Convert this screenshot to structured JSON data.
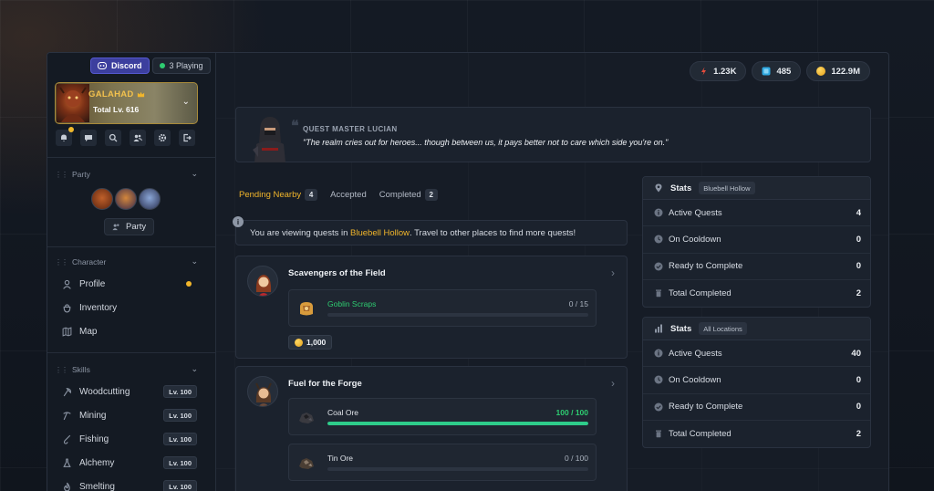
{
  "top": {
    "discord_label": "Discord",
    "playing_label": "3 Playing"
  },
  "hero": {
    "name": "GALAHAD",
    "level": "Total Lv. 616"
  },
  "sidebar": {
    "toolbar_icons": [
      "bell-icon",
      "chat-icon",
      "search-icon",
      "users-icon",
      "gear-icon",
      "logout-icon"
    ],
    "party": {
      "title": "Party",
      "button_label": "Party"
    },
    "character": {
      "title": "Character",
      "items": [
        {
          "label": "Profile",
          "icon": "user-icon",
          "has_notification": true
        },
        {
          "label": "Inventory",
          "icon": "bag-icon"
        },
        {
          "label": "Map",
          "icon": "map-icon"
        }
      ]
    },
    "skills": {
      "title": "Skills",
      "items": [
        {
          "label": "Woodcutting",
          "level": "Lv. 100",
          "icon": "axe-icon"
        },
        {
          "label": "Mining",
          "level": "Lv. 100",
          "icon": "pickaxe-icon"
        },
        {
          "label": "Fishing",
          "level": "Lv. 100",
          "icon": "fishing-icon"
        },
        {
          "label": "Alchemy",
          "level": "Lv. 100",
          "icon": "flask-icon"
        },
        {
          "label": "Smelting",
          "level": "Lv. 100",
          "icon": "flame-icon"
        }
      ]
    }
  },
  "resources": [
    {
      "value": "1.23K",
      "icon": "red-crystal-icon",
      "color": "#e74c3c"
    },
    {
      "value": "485",
      "icon": "blue-gem-icon",
      "color": "#2fa8e0"
    },
    {
      "value": "122.9M",
      "icon": "gold-coin-icon",
      "color": "#f2b62b"
    }
  ],
  "quest_master": {
    "title": "QUEST MASTER LUCIAN",
    "quote": "\"The realm cries out for heroes... though between us, it pays better not to care which side you're on.\""
  },
  "tabs": [
    {
      "label": "Pending Nearby",
      "count": "4",
      "active": true
    },
    {
      "label": "Accepted",
      "count": null,
      "active": false
    },
    {
      "label": "Completed",
      "count": "2",
      "active": false
    }
  ],
  "info": {
    "prefix": "You are viewing quests in ",
    "location": "Bluebell Hollow",
    "suffix": ". Travel to other places to find more quests!"
  },
  "quests": [
    {
      "title": "Scavengers of the Field",
      "objectives": [
        {
          "name": "Goblin Scraps",
          "count": "0 / 15",
          "progress": 0,
          "complete": false,
          "icon": "goblin-scraps-icon"
        }
      ],
      "reward": "1,000"
    },
    {
      "title": "Fuel for the Forge",
      "objectives": [
        {
          "name": "Coal Ore",
          "count": "100 / 100",
          "progress": 1,
          "complete": true,
          "icon": "coal-ore-icon"
        },
        {
          "name": "Tin Ore",
          "count": "0 / 100",
          "progress": 0,
          "complete": false,
          "icon": "tin-ore-icon"
        }
      ]
    }
  ],
  "stats_panels": [
    {
      "title": "Stats",
      "tag": "Bluebell Hollow",
      "icon": "location-pin-icon",
      "rows": [
        {
          "label": "Active Quests",
          "value": "4",
          "icon": "info-icon"
        },
        {
          "label": "On Cooldown",
          "value": "0",
          "icon": "clock-icon"
        },
        {
          "label": "Ready to Complete",
          "value": "0",
          "icon": "check-icon"
        },
        {
          "label": "Total Completed",
          "value": "2",
          "icon": "trash-icon"
        }
      ]
    },
    {
      "title": "Stats",
      "tag": "All Locations",
      "icon": "bar-chart-icon",
      "rows": [
        {
          "label": "Active Quests",
          "value": "40",
          "icon": "info-icon"
        },
        {
          "label": "On Cooldown",
          "value": "0",
          "icon": "clock-icon"
        },
        {
          "label": "Ready to Complete",
          "value": "0",
          "icon": "check-icon"
        },
        {
          "label": "Total Completed",
          "value": "2",
          "icon": "trash-icon"
        }
      ]
    }
  ]
}
